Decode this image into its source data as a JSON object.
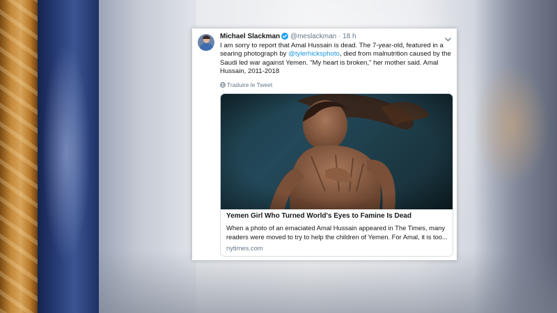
{
  "tweet": {
    "author_name": "Michael Slackman",
    "handle": "@meslackman",
    "separator": "·",
    "time": "18 h",
    "text_lines": [
      {
        "before": "I am sorry to report that Amal Hussain is dead. The 7-year-old, featured in a",
        "mention": "",
        "after": ""
      },
      {
        "before": "searing photograph by ",
        "mention": "@tylerhicksphoto",
        "after": ", died from malnutrition caused by the"
      },
      {
        "before": "Saudi led war against Yemen.  \"My heart is broken,\" her mother said. Amal",
        "mention": "",
        "after": ""
      },
      {
        "before": "Hussain, 2011-2018",
        "mention": "",
        "after": ""
      }
    ],
    "translate_label": "Traduire le Tweet",
    "card": {
      "title": "Yemen Girl Who Turned World's Eyes to Famine Is Dead",
      "description_lines": [
        "When a photo of an emaciated Amal Hussain appeared in The Times, many",
        "readers were moved to try to help the children of Yemen. For Amal, it is too..."
      ],
      "domain": "nytimes.com"
    }
  },
  "colors": {
    "link": "#1b95e0",
    "text": "#14171a",
    "secondary": "#657786",
    "verified": "#1da1f2",
    "channel_orange": "#c68a3a",
    "channel_blue": "#2a3f7a"
  },
  "icons": {
    "verified": "verified-badge-icon",
    "caret": "chevron-down-icon",
    "translate": "globe-icon"
  }
}
